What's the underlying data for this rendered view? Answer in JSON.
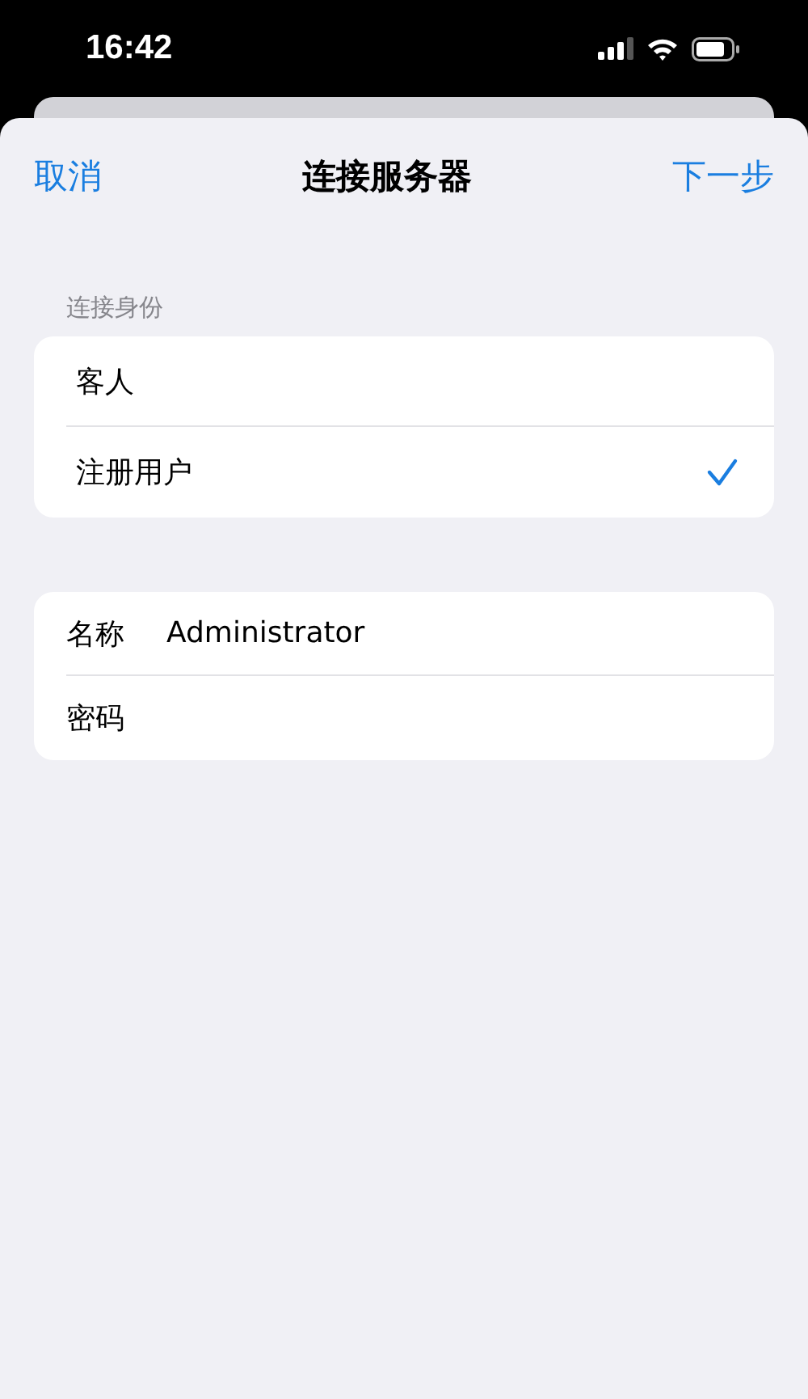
{
  "status_bar": {
    "time": "16:42"
  },
  "nav": {
    "cancel": "取消",
    "title": "连接服务器",
    "next": "下一步"
  },
  "identity": {
    "header": "连接身份",
    "options": [
      {
        "label": "客人",
        "selected": false
      },
      {
        "label": "注册用户",
        "selected": true
      }
    ]
  },
  "credentials": [
    {
      "label": "名称",
      "value": "Administrator",
      "kind": "text"
    },
    {
      "label": "密码",
      "kind": "password"
    }
  ]
}
